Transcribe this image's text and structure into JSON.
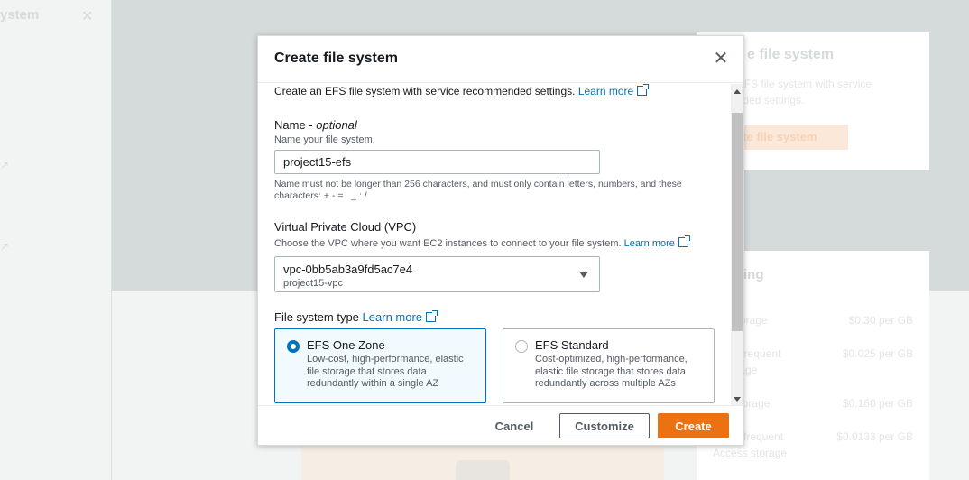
{
  "background": {
    "left_panel_title": "ystem",
    "card1": {
      "title": "e file system",
      "text": "e an EFS file system with service\nmmended settings.",
      "button": "ate file system"
    },
    "card2": {
      "title": "ing",
      "rows": [
        {
          "label": "ard storage",
          "value": "$0.30 per GB"
        },
        {
          "label": "ard-Infrequent\ns storage",
          "value": "$0.025 per GB"
        },
        {
          "label": "one storage",
          "value": "$0.160 per GB"
        },
        {
          "label": "one-Infrequent\nAccess storage",
          "value": "$0.0133 per GB"
        }
      ]
    }
  },
  "modal": {
    "title": "Create file system",
    "intro": "Create an EFS file system with service recommended settings.",
    "intro_link": "Learn more",
    "name_section": {
      "label": "Name -",
      "label_optional": "optional",
      "description": "Name your file system.",
      "value": "project15-efs",
      "constraint": "Name must not be longer than 256 characters, and must only contain letters, numbers, and these characters: + - = . _ : /"
    },
    "vpc_section": {
      "label": "Virtual Private Cloud (VPC)",
      "description": "Choose the VPC where you want EC2 instances to connect to your file system.",
      "link": "Learn more",
      "selected_id": "vpc-0bb5ab3a9fd5ac7e4",
      "selected_name": "project15-vpc"
    },
    "type_section": {
      "label": "File system type",
      "link": "Learn more",
      "options": [
        {
          "title": "EFS One Zone",
          "description": "Low-cost, high-performance, elastic file storage that stores data redundantly within a single AZ",
          "selected": true
        },
        {
          "title": "EFS Standard",
          "description": "Cost-optimized, high-performance, elastic file storage that stores data redundantly across multiple AZs",
          "selected": false
        }
      ]
    },
    "footer": {
      "cancel": "Cancel",
      "customize": "Customize",
      "create": "Create"
    }
  },
  "colors": {
    "link": "#0073bb",
    "primary_button": "#ec7211",
    "selected_tile_bg": "#f1faff"
  }
}
